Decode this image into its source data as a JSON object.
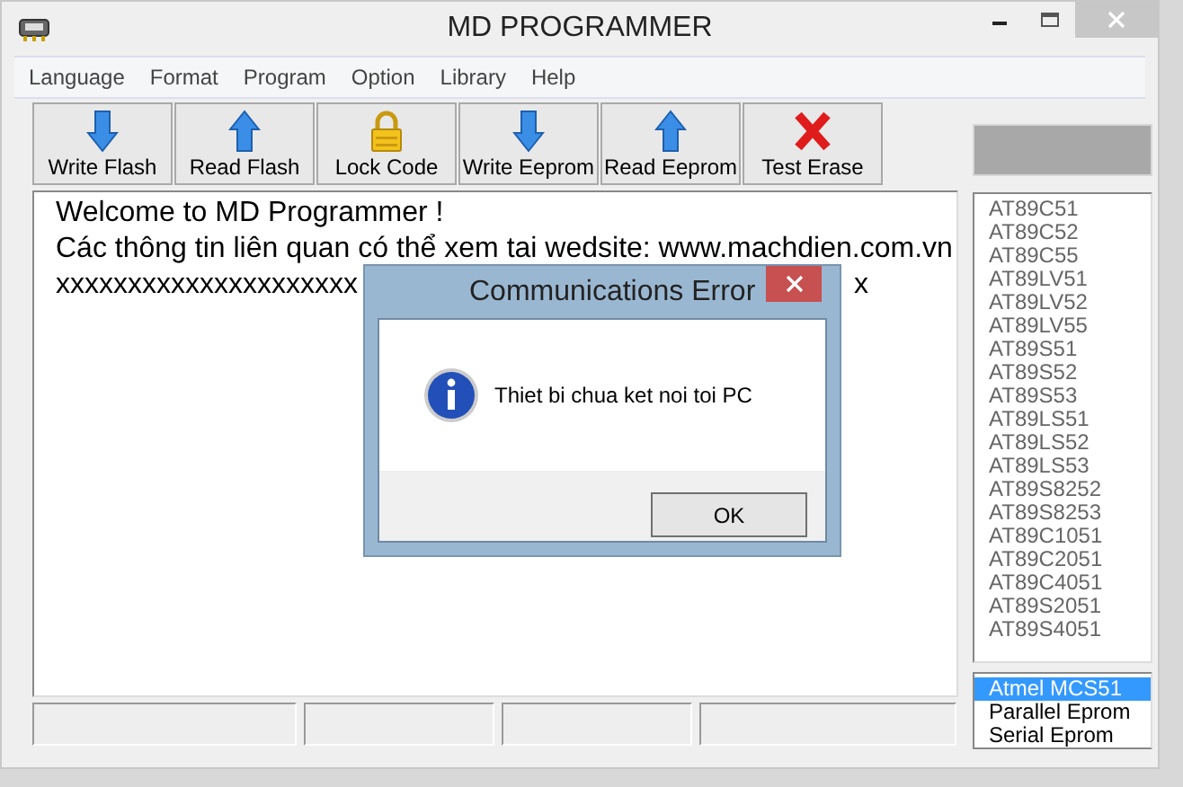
{
  "window": {
    "title": "MD PROGRAMMER"
  },
  "menu": [
    "Language",
    "Format",
    "Program",
    "Option",
    "Library",
    "Help"
  ],
  "toolbar": [
    {
      "label": "Write Flash",
      "kind": "write"
    },
    {
      "label": "Read Flash",
      "kind": "read"
    },
    {
      "label": "Lock Code",
      "kind": "lock"
    },
    {
      "label": "Write Eeprom",
      "kind": "write"
    },
    {
      "label": "Read Eeprom",
      "kind": "read"
    },
    {
      "label": "Test Erase",
      "kind": "erase"
    }
  ],
  "log": {
    "lines": [
      "Welcome to MD Programmer !",
      "Các thông tin liên quan có thể xem tai wedsite: www.machdien.com.vn"
    ],
    "covered_line": {
      "left": "xxxxxxxxxxxxxxxxxxxxx",
      "right": "x"
    }
  },
  "devices": [
    "AT89C51",
    "AT89C52",
    "AT89C55",
    "AT89LV51",
    "AT89LV52",
    "AT89LV55",
    "AT89S51",
    "AT89S52",
    "AT89S53",
    "AT89LS51",
    "AT89LS52",
    "AT89LS53",
    "AT89S8252",
    "AT89S8253",
    "AT89C1051",
    "AT89C2051",
    "AT89C4051",
    "AT89S2051",
    "AT89S4051"
  ],
  "families": [
    {
      "label": "Atmel MCS51",
      "selected": true
    },
    {
      "label": "Parallel Eprom",
      "selected": false
    },
    {
      "label": "Serial Eprom",
      "selected": false
    }
  ],
  "dialog": {
    "title": "Communications Error",
    "message": "Thiet bi chua ket noi toi PC",
    "button": "OK"
  }
}
